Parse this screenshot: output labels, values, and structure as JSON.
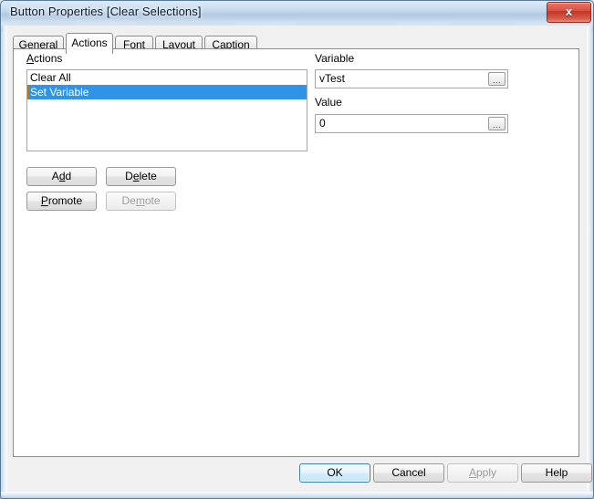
{
  "window": {
    "title": "Button Properties [Clear Selections]",
    "close_icon": "close-x-icon",
    "close_label": "x"
  },
  "tabs": [
    {
      "label": "General",
      "active": false
    },
    {
      "label": "Actions",
      "active": true
    },
    {
      "label": "Font",
      "active": false
    },
    {
      "label": "Layout",
      "active": false
    },
    {
      "label": "Caption",
      "active": false
    }
  ],
  "actions_group": {
    "label": "Actions",
    "accelerator": "A",
    "items": [
      {
        "label": "Clear All",
        "selected": false
      },
      {
        "label": "Set Variable",
        "selected": true
      }
    ]
  },
  "list_buttons": [
    {
      "label": "Add",
      "accelerator": "d",
      "enabled": true
    },
    {
      "label": "Delete",
      "accelerator": "e",
      "enabled": true
    },
    {
      "label": "Promote",
      "accelerator": "P",
      "enabled": true
    },
    {
      "label": "Demote",
      "accelerator": "m",
      "enabled": false
    }
  ],
  "fields": {
    "variable": {
      "label": "Variable",
      "value": "vTest",
      "placeholder": "",
      "browse_icon": "ellipsis-icon",
      "browse_label": "..."
    },
    "value": {
      "label": "Value",
      "value": "0",
      "placeholder": "",
      "browse_icon": "ellipsis-icon",
      "browse_label": "..."
    }
  },
  "command_buttons": [
    {
      "label": "OK",
      "enabled": true,
      "default": true
    },
    {
      "label": "Cancel",
      "enabled": true,
      "default": false
    },
    {
      "label": "Apply",
      "enabled": false,
      "default": false
    },
    {
      "label": "Help",
      "enabled": true,
      "default": false
    }
  ],
  "colors": {
    "selection_blue": "#2f93e8",
    "close_red": "#c23323",
    "default_button_blue": "#3c7fb1",
    "dialog_face": "#f0f0f0",
    "panel_white": "#ffffff"
  }
}
